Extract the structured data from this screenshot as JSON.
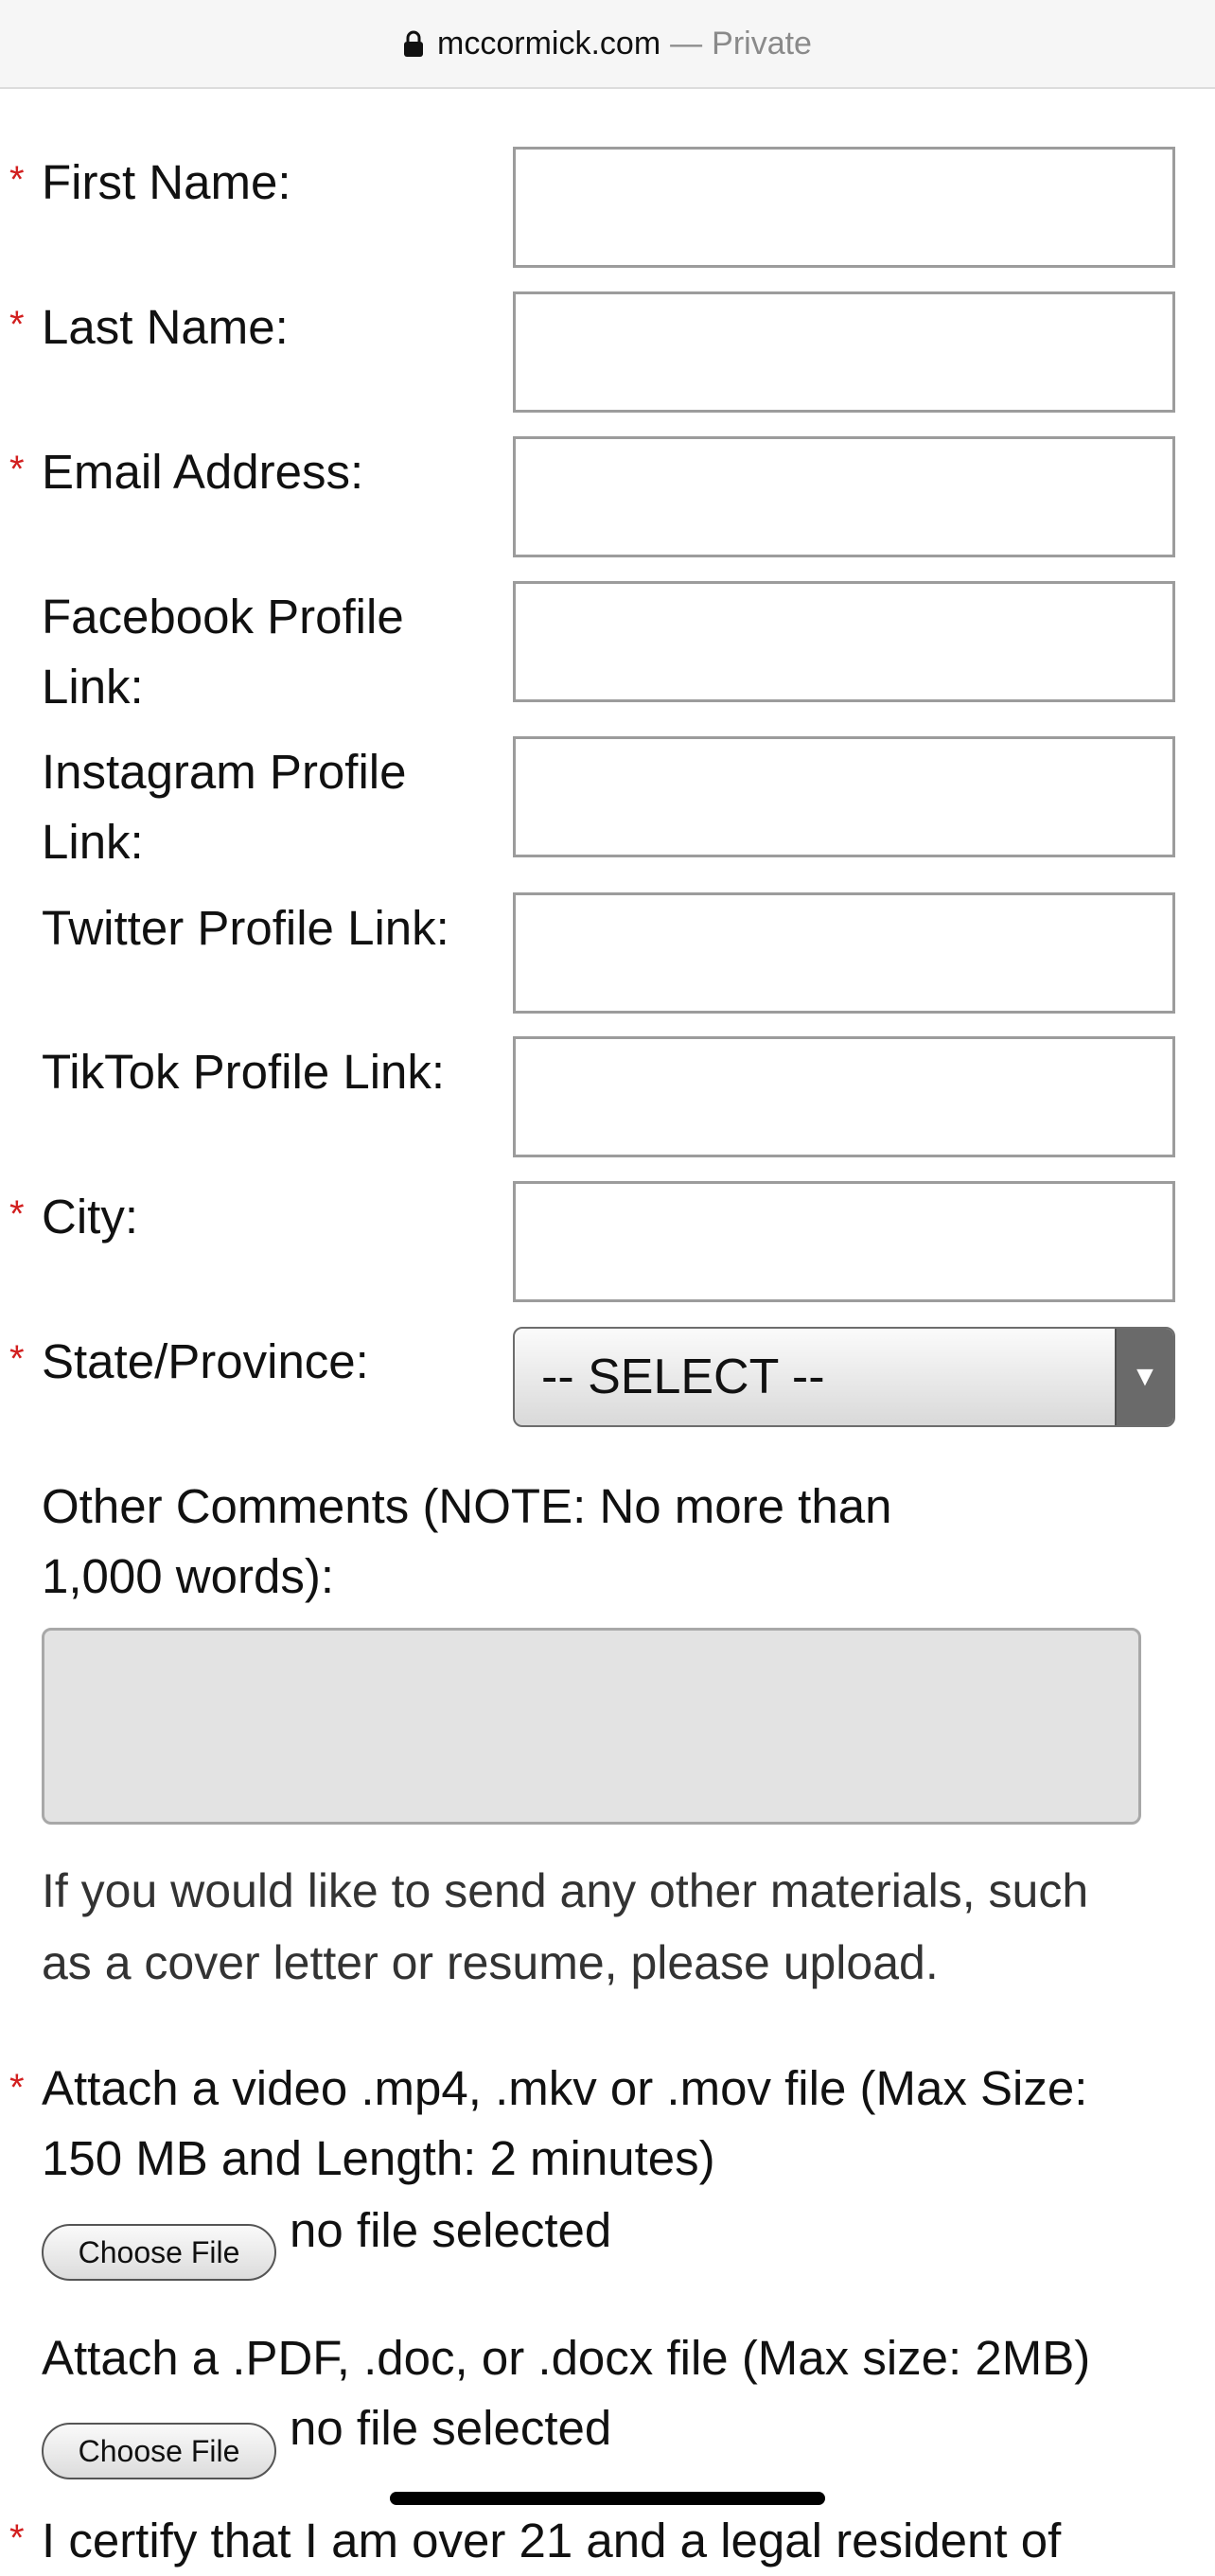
{
  "browser": {
    "host": "mccormick.com",
    "separator": "—",
    "mode": "Private",
    "lock_icon": "lock-icon"
  },
  "required_marker": "*",
  "fields": {
    "first_name": "First Name:",
    "last_name": "Last Name:",
    "email": "Email Address:",
    "facebook_1": "Facebook Profile",
    "facebook_2": "Link:",
    "instagram_1": "Instagram Profile",
    "instagram_2": "Link:",
    "twitter": "Twitter Profile Link:",
    "tiktok": "TikTok Profile Link:",
    "city": "City:",
    "state": "State/Province:"
  },
  "state_select": {
    "value": "-- SELECT --",
    "arrow": "▼"
  },
  "comments": {
    "label_1": "Other Comments (NOTE: No more than",
    "label_2": "1,000 words):"
  },
  "materials_note": {
    "line_1": "If you would like to send any other materials, such",
    "line_2": "as a cover letter or resume, please upload."
  },
  "video_upload": {
    "label_1": "Attach a video .mp4, .mkv or .mov file (Max Size:",
    "label_2": "150 MB and Length: 2 minutes)",
    "button": "Choose File",
    "status": "no file selected"
  },
  "doc_upload": {
    "label": "Attach a .PDF, .doc, or .docx file (Max size: 2MB)",
    "button": "Choose File",
    "status": "no file selected"
  },
  "cutoff_text": "I certify that I am over 21 and a legal resident of"
}
